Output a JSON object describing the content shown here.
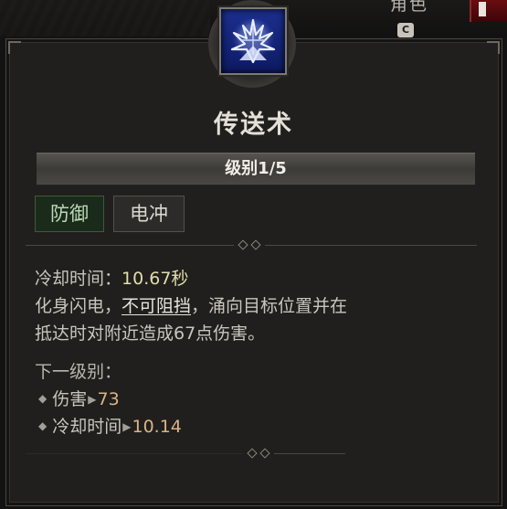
{
  "header": {
    "character_tab_label": "角色",
    "character_tab_key": "C"
  },
  "skill": {
    "icon": "teleport-lightning-icon",
    "name": "传送术",
    "rank_label": "级别1/5",
    "tags": [
      "防御",
      "电冲"
    ],
    "cooldown_label": "冷却时间：",
    "cooldown_value": "10.67秒",
    "description": {
      "part1": "化身闪电，",
      "unstoppable": "不可阻挡",
      "part2": "，涌向目标位置并在",
      "line2": "抵达时对附近造成67点伤害。"
    },
    "next_rank": {
      "label": "下一级别：",
      "damage_label": "伤害",
      "damage_value": "73",
      "cooldown_label": "冷却时间",
      "cooldown_value": "10.14"
    }
  },
  "colors": {
    "panel_bg": "#201f1d",
    "icon_bg": "#1b2f8e",
    "defense_tag": "#1a2b1b",
    "cooldown_value": "#e2ddaa",
    "next_value": "#d9b486"
  }
}
